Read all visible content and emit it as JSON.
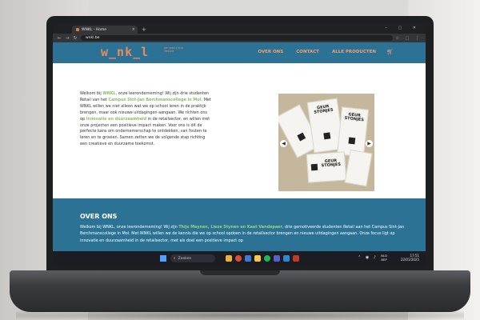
{
  "browser": {
    "tab_title": "WNKL - Home",
    "tab_close": "×",
    "new_tab": "+",
    "url": "wnkl.be",
    "window_controls": "–  ▢  ✕"
  },
  "site": {
    "logo": "w_nk_l",
    "logo_tagline": "we need a kind lifestyle",
    "menu": [
      "OVER ONS",
      "CONTACT",
      "ALLE PRODUCTEN"
    ],
    "accent_color": "#2b7295",
    "highlight_color": "#8bbf6a",
    "logo_color": "#e98a60"
  },
  "intro": {
    "t1": "Welkom bij ",
    "h1": "WNKL",
    "t2": ", onze leeronderneming! Wij zijn drie studenten Retail van het ",
    "h2": "Campus Sint-Jan Berchmanscollege in Mol.",
    "t3": " Met WNKL willen we niet alleen wat we op school leren in de praktijk brengen, maar ook nieuwe uitdagingen aangaan. We richten ons op ",
    "h3": "innovatie en duurzaamheid",
    "t4": " in de retailsector, en willen met onze projecten een positieve impact maken. Voor ons is dit de perfecte kans om ondernemerschap te ontdekken, van fouten te leren en te groeien. Samen zetten we de volgende stap richting een creatieve en duurzame toekomst."
  },
  "product_image": {
    "label1": "GEUR STONJES",
    "label2": "GEUR STONJES",
    "label3": "GEUR STONJES"
  },
  "over_ons": {
    "heading": "OVER ONS",
    "t1": "Welkom bij WNKL, onze leeronderneming! Wij zijn ",
    "names": "Thijs Meynen, Lieze Stynen en Kaat Vandepaer",
    "t2": ", drie gemotiveerde studenten Retail aan het Campus Sint-Jan Berchmanscollege in Mol. Met WNKL willen we de kennis die we op school opdoen in de retailsector brengen en nieuwe uitdagingen aangaan. Onze focus ligt op innovatie en duurzaamheid in de retailsector, met als doel een positieve impact op"
  },
  "taskbar": {
    "search_placeholder": "Zoeken",
    "lang_line1": "NLD",
    "lang_line2": "BEP",
    "time": "17:51",
    "date": "22/01/2025"
  }
}
